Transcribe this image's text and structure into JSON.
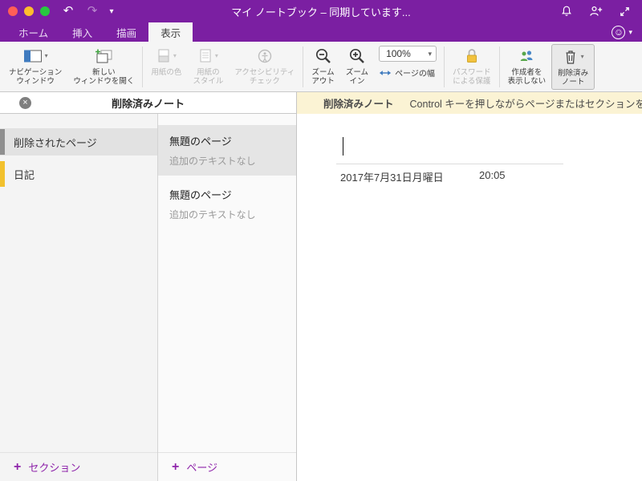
{
  "titlebar": {
    "title": "マイ ノートブック – 同期しています...",
    "undo_glyph": "↶",
    "redo_glyph": "↷",
    "chevron_glyph": "▾"
  },
  "tabbar": {
    "tabs": [
      {
        "label": "ホーム"
      },
      {
        "label": "挿入"
      },
      {
        "label": "描画"
      },
      {
        "label": "表示"
      }
    ],
    "smiley_glyph": "☺",
    "smiley_chevron": "▾"
  },
  "ribbon": {
    "nav_window_label": "ナビゲーション\nウィンドウ",
    "new_window_label": "新しい\nウィンドウを開く",
    "paper_color_label": "用紙の色",
    "paper_style_label": "用紙の\nスタイル",
    "accessibility_label": "アクセシビリティ\nチェック",
    "zoom_out_label": "ズーム\nアウト",
    "zoom_in_label": "ズーム\nイン",
    "zoom_value": "100%",
    "page_width_label": "ページの幅",
    "password_label": "パスワード\nによる保護",
    "hide_authors_label": "作成者を\n表示しない",
    "deleted_notes_label": "削除済み\nノート",
    "dropdown_glyph": "▾"
  },
  "notebook_panel": {
    "header_title": "削除済みノート",
    "close_glyph": "×",
    "sections": [
      {
        "label": "削除されたページ",
        "color": "#8f8f8f"
      },
      {
        "label": "日記",
        "color": "#f2c12e"
      }
    ],
    "add_section_label": "セクション",
    "pages": [
      {
        "title": "無題のページ",
        "subtitle": "追加のテキストなし"
      },
      {
        "title": "無題のページ",
        "subtitle": "追加のテキストなし"
      }
    ],
    "add_page_label": "ページ",
    "plus_glyph": "+"
  },
  "main": {
    "infobar_title": "削除済みノート",
    "infobar_message": "Control キーを押しながらページまたはセクションをクリ",
    "page_date": "2017年7月31日月曜日",
    "page_time": "20:05"
  },
  "colors": {
    "accent_purple": "#7B1FA2",
    "infobar_bg": "#FBF3D4",
    "section_tab_gray": "#8f8f8f",
    "section_tab_yellow": "#f2c12e"
  }
}
